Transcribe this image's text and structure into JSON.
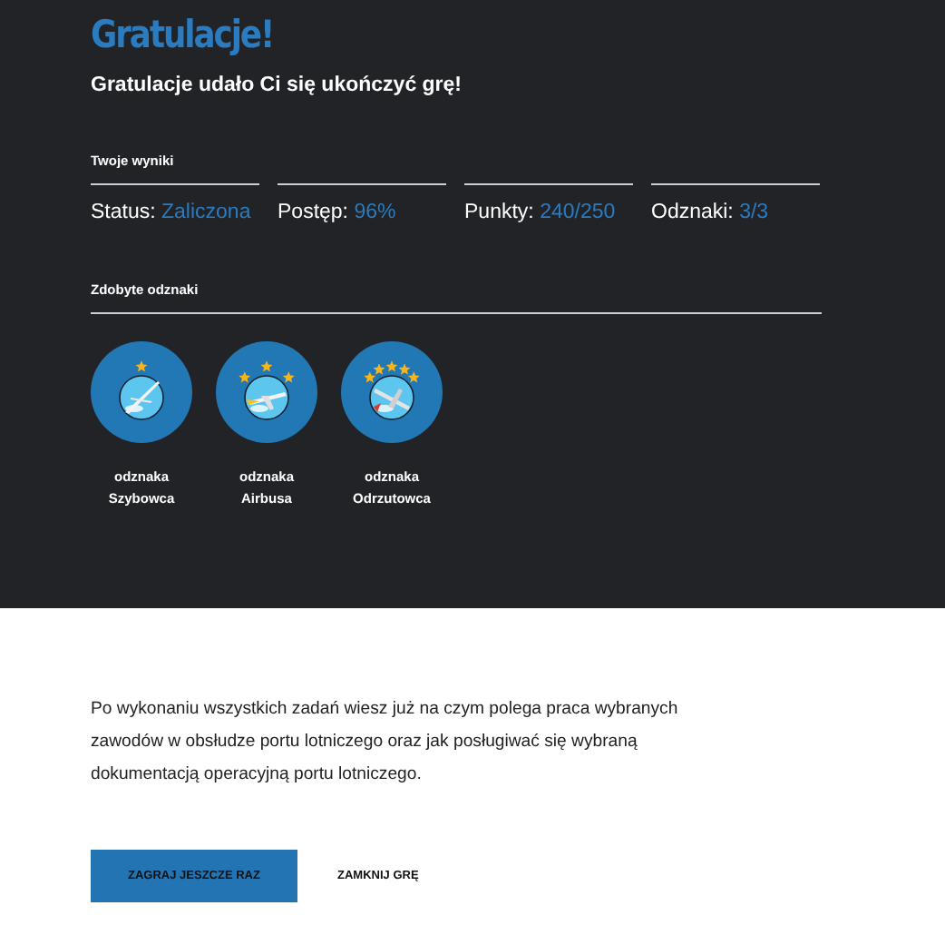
{
  "header": {
    "title": "Gratulacje!",
    "subtitle": "Gratulacje udało Ci się ukończyć grę!"
  },
  "results": {
    "heading": "Twoje wyniki",
    "items": [
      {
        "label": "Status:",
        "value": "Zaliczona"
      },
      {
        "label": "Postęp:",
        "value": "96%"
      },
      {
        "label": "Punkty:",
        "value": "240/250"
      },
      {
        "label": "Odznaki:",
        "value": "3/3"
      }
    ]
  },
  "badges": {
    "heading": "Zdobyte odznaki",
    "items": [
      {
        "line1": "odznaka",
        "line2": "Szybowca",
        "kind": "glider"
      },
      {
        "line1": "odznaka",
        "line2": "Airbusa",
        "kind": "airliner"
      },
      {
        "line1": "odznaka",
        "line2": "Odrzutowca",
        "kind": "jet"
      }
    ]
  },
  "summary": "Po wykonaniu wszystkich zadań wiesz już na czym polega praca wybranych zawodów w obsłudze portu lotniczego oraz jak posługiwać się wybraną dokumentacją operacyjną portu lotniczego.",
  "buttons": [
    {
      "label": "ZAGRAJ JESZCZE RAZ",
      "primary": true
    },
    {
      "label": "ZAMKNIJ GRĘ",
      "primary": false
    }
  ]
}
